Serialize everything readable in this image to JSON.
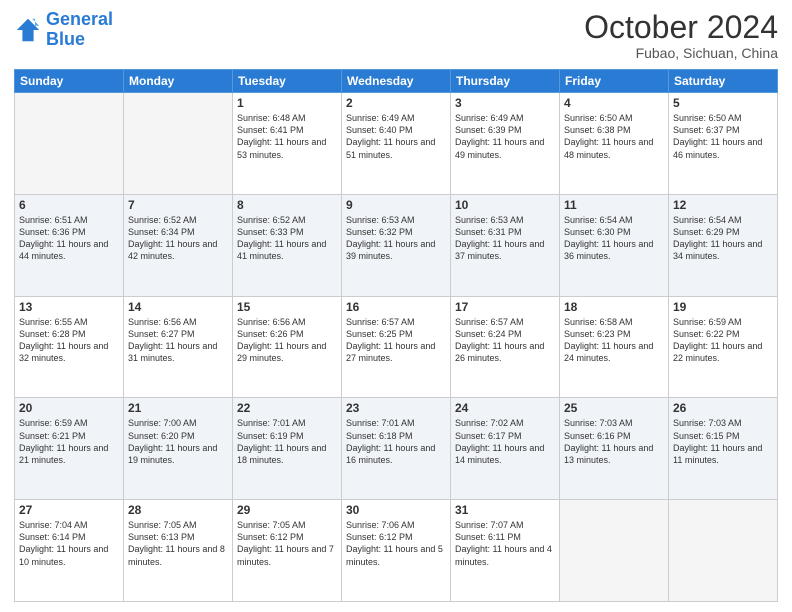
{
  "header": {
    "logo_general": "General",
    "logo_blue": "Blue",
    "month": "October 2024",
    "location": "Fubao, Sichuan, China"
  },
  "weekdays": [
    "Sunday",
    "Monday",
    "Tuesday",
    "Wednesday",
    "Thursday",
    "Friday",
    "Saturday"
  ],
  "weeks": [
    [
      {
        "day": "",
        "info": ""
      },
      {
        "day": "",
        "info": ""
      },
      {
        "day": "1",
        "info": "Sunrise: 6:48 AM\nSunset: 6:41 PM\nDaylight: 11 hours and 53 minutes."
      },
      {
        "day": "2",
        "info": "Sunrise: 6:49 AM\nSunset: 6:40 PM\nDaylight: 11 hours and 51 minutes."
      },
      {
        "day": "3",
        "info": "Sunrise: 6:49 AM\nSunset: 6:39 PM\nDaylight: 11 hours and 49 minutes."
      },
      {
        "day": "4",
        "info": "Sunrise: 6:50 AM\nSunset: 6:38 PM\nDaylight: 11 hours and 48 minutes."
      },
      {
        "day": "5",
        "info": "Sunrise: 6:50 AM\nSunset: 6:37 PM\nDaylight: 11 hours and 46 minutes."
      }
    ],
    [
      {
        "day": "6",
        "info": "Sunrise: 6:51 AM\nSunset: 6:36 PM\nDaylight: 11 hours and 44 minutes."
      },
      {
        "day": "7",
        "info": "Sunrise: 6:52 AM\nSunset: 6:34 PM\nDaylight: 11 hours and 42 minutes."
      },
      {
        "day": "8",
        "info": "Sunrise: 6:52 AM\nSunset: 6:33 PM\nDaylight: 11 hours and 41 minutes."
      },
      {
        "day": "9",
        "info": "Sunrise: 6:53 AM\nSunset: 6:32 PM\nDaylight: 11 hours and 39 minutes."
      },
      {
        "day": "10",
        "info": "Sunrise: 6:53 AM\nSunset: 6:31 PM\nDaylight: 11 hours and 37 minutes."
      },
      {
        "day": "11",
        "info": "Sunrise: 6:54 AM\nSunset: 6:30 PM\nDaylight: 11 hours and 36 minutes."
      },
      {
        "day": "12",
        "info": "Sunrise: 6:54 AM\nSunset: 6:29 PM\nDaylight: 11 hours and 34 minutes."
      }
    ],
    [
      {
        "day": "13",
        "info": "Sunrise: 6:55 AM\nSunset: 6:28 PM\nDaylight: 11 hours and 32 minutes."
      },
      {
        "day": "14",
        "info": "Sunrise: 6:56 AM\nSunset: 6:27 PM\nDaylight: 11 hours and 31 minutes."
      },
      {
        "day": "15",
        "info": "Sunrise: 6:56 AM\nSunset: 6:26 PM\nDaylight: 11 hours and 29 minutes."
      },
      {
        "day": "16",
        "info": "Sunrise: 6:57 AM\nSunset: 6:25 PM\nDaylight: 11 hours and 27 minutes."
      },
      {
        "day": "17",
        "info": "Sunrise: 6:57 AM\nSunset: 6:24 PM\nDaylight: 11 hours and 26 minutes."
      },
      {
        "day": "18",
        "info": "Sunrise: 6:58 AM\nSunset: 6:23 PM\nDaylight: 11 hours and 24 minutes."
      },
      {
        "day": "19",
        "info": "Sunrise: 6:59 AM\nSunset: 6:22 PM\nDaylight: 11 hours and 22 minutes."
      }
    ],
    [
      {
        "day": "20",
        "info": "Sunrise: 6:59 AM\nSunset: 6:21 PM\nDaylight: 11 hours and 21 minutes."
      },
      {
        "day": "21",
        "info": "Sunrise: 7:00 AM\nSunset: 6:20 PM\nDaylight: 11 hours and 19 minutes."
      },
      {
        "day": "22",
        "info": "Sunrise: 7:01 AM\nSunset: 6:19 PM\nDaylight: 11 hours and 18 minutes."
      },
      {
        "day": "23",
        "info": "Sunrise: 7:01 AM\nSunset: 6:18 PM\nDaylight: 11 hours and 16 minutes."
      },
      {
        "day": "24",
        "info": "Sunrise: 7:02 AM\nSunset: 6:17 PM\nDaylight: 11 hours and 14 minutes."
      },
      {
        "day": "25",
        "info": "Sunrise: 7:03 AM\nSunset: 6:16 PM\nDaylight: 11 hours and 13 minutes."
      },
      {
        "day": "26",
        "info": "Sunrise: 7:03 AM\nSunset: 6:15 PM\nDaylight: 11 hours and 11 minutes."
      }
    ],
    [
      {
        "day": "27",
        "info": "Sunrise: 7:04 AM\nSunset: 6:14 PM\nDaylight: 11 hours and 10 minutes."
      },
      {
        "day": "28",
        "info": "Sunrise: 7:05 AM\nSunset: 6:13 PM\nDaylight: 11 hours and 8 minutes."
      },
      {
        "day": "29",
        "info": "Sunrise: 7:05 AM\nSunset: 6:12 PM\nDaylight: 11 hours and 7 minutes."
      },
      {
        "day": "30",
        "info": "Sunrise: 7:06 AM\nSunset: 6:12 PM\nDaylight: 11 hours and 5 minutes."
      },
      {
        "day": "31",
        "info": "Sunrise: 7:07 AM\nSunset: 6:11 PM\nDaylight: 11 hours and 4 minutes."
      },
      {
        "day": "",
        "info": ""
      },
      {
        "day": "",
        "info": ""
      }
    ]
  ]
}
